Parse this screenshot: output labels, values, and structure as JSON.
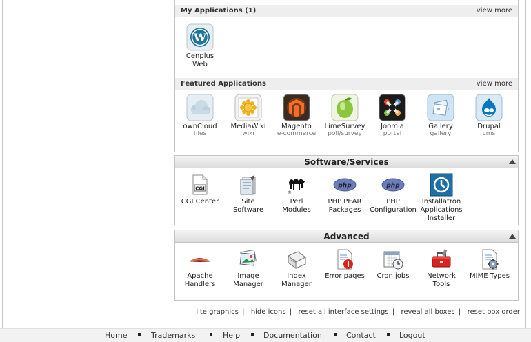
{
  "my_apps": {
    "title": "My Applications (1)",
    "more": "view more",
    "items": [
      {
        "label1": "Cenplus",
        "label2": "Web",
        "icon": "wordpress-icon"
      }
    ]
  },
  "featured": {
    "title": "Featured Applications",
    "more": "view more",
    "items": [
      {
        "label": "ownCloud",
        "sub": "files",
        "icon": "owncloud-icon"
      },
      {
        "label": "MediaWiki",
        "sub": "wiki",
        "icon": "mediawiki-icon"
      },
      {
        "label": "Magento",
        "sub": "e-commerce",
        "icon": "magento-icon"
      },
      {
        "label": "LimeSurvey",
        "sub": "poll/survey",
        "icon": "limesurvey-icon"
      },
      {
        "label": "Joomla",
        "sub": "portal",
        "icon": "joomla-icon"
      },
      {
        "label": "Gallery",
        "sub": "gallery",
        "icon": "gallery-icon"
      },
      {
        "label": "Drupal",
        "sub": "cms",
        "icon": "drupal-icon"
      }
    ]
  },
  "software": {
    "title": "Software/Services",
    "items": [
      {
        "lines": [
          "CGI Center"
        ],
        "icon": "cgi-icon"
      },
      {
        "lines": [
          "Site",
          "Software"
        ],
        "icon": "site-software-icon"
      },
      {
        "lines": [
          "Perl",
          "Modules"
        ],
        "icon": "perl-camel-icon"
      },
      {
        "lines": [
          "PHP PEAR",
          "Packages"
        ],
        "icon": "php-icon"
      },
      {
        "lines": [
          "PHP",
          "Configuration"
        ],
        "icon": "php-icon"
      },
      {
        "lines": [
          "Installatron",
          "Applications",
          "Installer"
        ],
        "icon": "installatron-icon"
      }
    ]
  },
  "advanced": {
    "title": "Advanced",
    "items": [
      {
        "lines": [
          "Apache",
          "Handlers"
        ],
        "icon": "feather-icon"
      },
      {
        "lines": [
          "Image",
          "Manager"
        ],
        "icon": "image-manager-icon"
      },
      {
        "lines": [
          "Index",
          "Manager"
        ],
        "icon": "index-manager-icon"
      },
      {
        "lines": [
          "Error pages"
        ],
        "icon": "error-page-icon"
      },
      {
        "lines": [
          "Cron jobs"
        ],
        "icon": "calendar-clock-icon"
      },
      {
        "lines": [
          "Network",
          "Tools"
        ],
        "icon": "toolbox-icon"
      },
      {
        "lines": [
          "MIME Types"
        ],
        "icon": "mime-gear-icon"
      }
    ]
  },
  "links": [
    "lite graphics",
    "hide icons",
    "reset all interface settings",
    "reveal all boxes",
    "reset box order"
  ],
  "footer": [
    "Home",
    "Trademarks",
    "Help",
    "Documentation",
    "Contact",
    "Logout"
  ]
}
